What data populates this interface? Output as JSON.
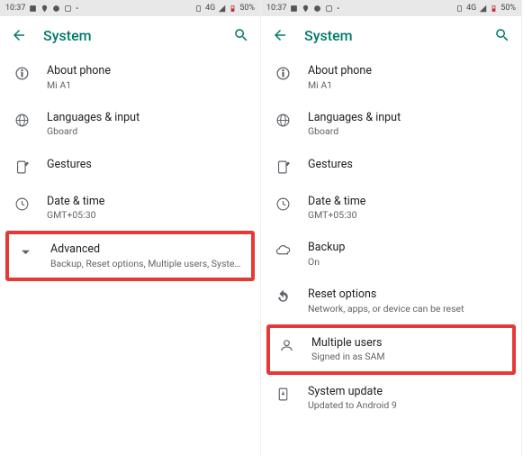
{
  "left": {
    "status": {
      "time": "10:37",
      "net": "4G",
      "battery": "50%"
    },
    "title": "System",
    "items": [
      {
        "title": "About phone",
        "sub": "Mi A1"
      },
      {
        "title": "Languages & input",
        "sub": "Gboard"
      },
      {
        "title": "Gestures",
        "sub": ""
      },
      {
        "title": "Date & time",
        "sub": "GMT+05:30"
      },
      {
        "title": "Advanced",
        "sub": "Backup, Reset options, Multiple users, System updat…"
      }
    ]
  },
  "right": {
    "status": {
      "time": "10:37",
      "net": "4G",
      "battery": "50%"
    },
    "title": "System",
    "items": [
      {
        "title": "About phone",
        "sub": "Mi A1"
      },
      {
        "title": "Languages & input",
        "sub": "Gboard"
      },
      {
        "title": "Gestures",
        "sub": ""
      },
      {
        "title": "Date & time",
        "sub": "GMT+05:30"
      },
      {
        "title": "Backup",
        "sub": "On"
      },
      {
        "title": "Reset options",
        "sub": "Network, apps, or device can be reset"
      },
      {
        "title": "Multiple users",
        "sub": "Signed in as SAM"
      },
      {
        "title": "System update",
        "sub": "Updated to Android 9"
      }
    ]
  }
}
